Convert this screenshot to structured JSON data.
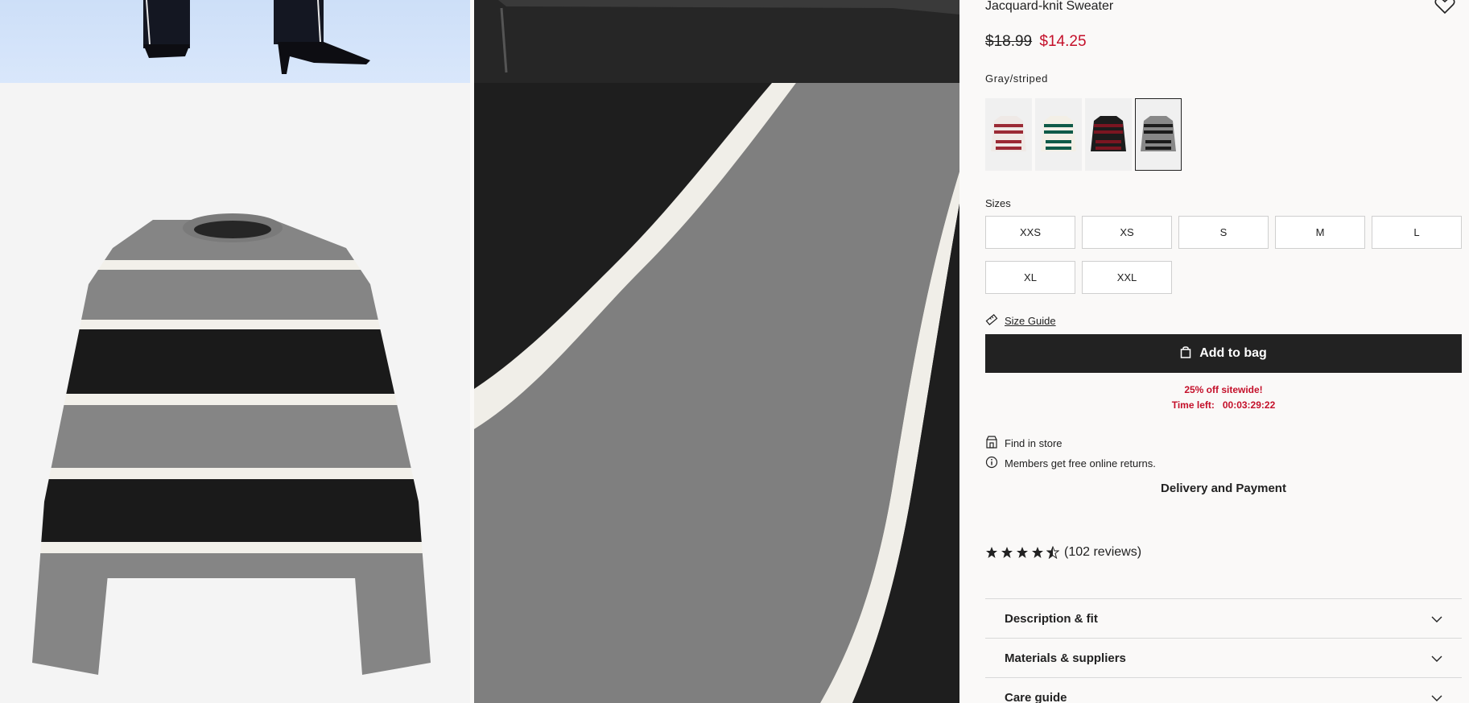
{
  "product": {
    "title": "Jacquard-knit Sweater",
    "price_old": "$18.99",
    "price_new": "$14.25",
    "color_name": "Gray/striped"
  },
  "colors": [
    {
      "name": "white-red-stripe",
      "stripe": "#9b2a35",
      "base": "#efe9e6"
    },
    {
      "name": "cream-green-stripe",
      "stripe": "#0f5a48",
      "base": "#f3efe6"
    },
    {
      "name": "black-red-stripe",
      "stripe": "#7a1521",
      "base": "#1c1c1c"
    },
    {
      "name": "gray-black-stripe",
      "stripe": "#1c1c1c",
      "base": "#888888"
    }
  ],
  "sizes": {
    "label": "Sizes",
    "options": [
      "XXS",
      "XS",
      "S",
      "M",
      "L",
      "XL",
      "XXL"
    ]
  },
  "actions": {
    "size_guide": "Size Guide",
    "add_to_bag": "Add to bag"
  },
  "promo": {
    "line1": "25% off sitewide!",
    "time_label": "Time left:",
    "time_value": "00:03:29:22"
  },
  "info": {
    "find_in_store": "Find in store",
    "free_returns": "Members get free online returns.",
    "delivery": "Delivery and Payment"
  },
  "reviews": {
    "rating": 4.5,
    "text": "(102 reviews)"
  },
  "accordions": [
    "Description & fit",
    "Materials & suppliers",
    "Care guide"
  ],
  "theme": {
    "sale_red": "#c4102a",
    "button_dark": "#222222"
  }
}
